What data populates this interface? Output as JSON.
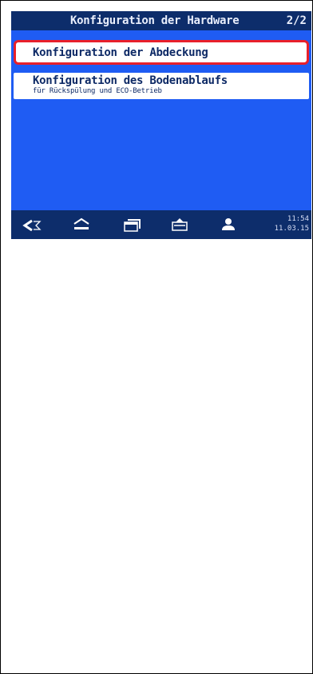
{
  "header": {
    "title": "Konfiguration der Hardware",
    "page_indicator": "2/2"
  },
  "menu": {
    "items": [
      {
        "label": "Konfiguration der Abdeckung",
        "sublabel": "",
        "selected": true
      },
      {
        "label": "Konfiguration des Bodenablaufs",
        "sublabel": "für Rückspülung und ECO-Betrieb",
        "selected": false
      }
    ]
  },
  "navbar": {
    "buttons": [
      {
        "icon": "back-icon"
      },
      {
        "icon": "home-icon"
      },
      {
        "icon": "windows-icon"
      },
      {
        "icon": "tray-icon"
      },
      {
        "icon": "user-icon"
      }
    ],
    "time": "11:54",
    "date": "11.03.15"
  },
  "colors": {
    "screen_background": "#1f5cf3",
    "bar_background": "#0d2d6b",
    "selection_border": "#e8202b",
    "item_text": "#0e2a66"
  }
}
